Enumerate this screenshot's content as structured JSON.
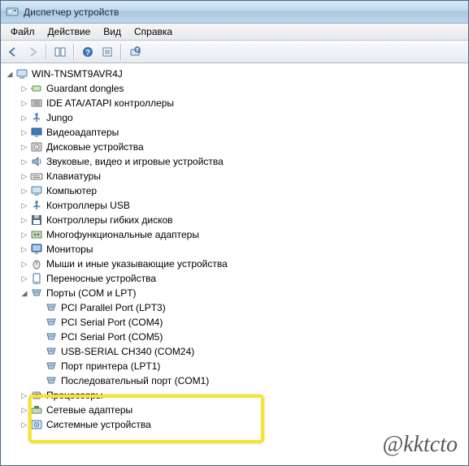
{
  "title": "Диспетчер устройств",
  "menu": {
    "file": "Файл",
    "action": "Действие",
    "view": "Вид",
    "help": "Справка"
  },
  "root": "WIN-TNSMT9AVR4J",
  "cats": [
    {
      "label": "Guardant dongles",
      "icon": "dongle"
    },
    {
      "label": "IDE ATA/ATAPI контроллеры",
      "icon": "ide"
    },
    {
      "label": "Jungo",
      "icon": "usb"
    },
    {
      "label": "Видеоадаптеры",
      "icon": "display"
    },
    {
      "label": "Дисковые устройства",
      "icon": "disk"
    },
    {
      "label": "Звуковые, видео и игровые устройства",
      "icon": "sound"
    },
    {
      "label": "Клавиатуры",
      "icon": "keyboard"
    },
    {
      "label": "Компьютер",
      "icon": "computer"
    },
    {
      "label": "Контроллеры USB",
      "icon": "usb"
    },
    {
      "label": "Контроллеры гибких дисков",
      "icon": "floppy"
    },
    {
      "label": "Многофункциональные адаптеры",
      "icon": "multi"
    },
    {
      "label": "Мониторы",
      "icon": "monitor"
    },
    {
      "label": "Мыши и иные указывающие устройства",
      "icon": "mouse"
    },
    {
      "label": "Переносные устройства",
      "icon": "portable"
    }
  ],
  "ports_label": "Порты (COM и LPT)",
  "ports": [
    {
      "label": "PCI Parallel Port (LPT3)"
    },
    {
      "label": "PCI Serial Port (COM4)"
    },
    {
      "label": "PCI Serial Port (COM5)"
    },
    {
      "label": "USB-SERIAL CH340 (COM24)"
    },
    {
      "label": "Порт принтера (LPT1)"
    },
    {
      "label": "Последовательный порт (COM1)"
    }
  ],
  "tail": [
    {
      "label": "Процессоры",
      "icon": "cpu"
    },
    {
      "label": "Сетевые адаптеры",
      "icon": "net"
    },
    {
      "label": "Системные устройства",
      "icon": "system"
    }
  ],
  "watermark": "@kktcto"
}
